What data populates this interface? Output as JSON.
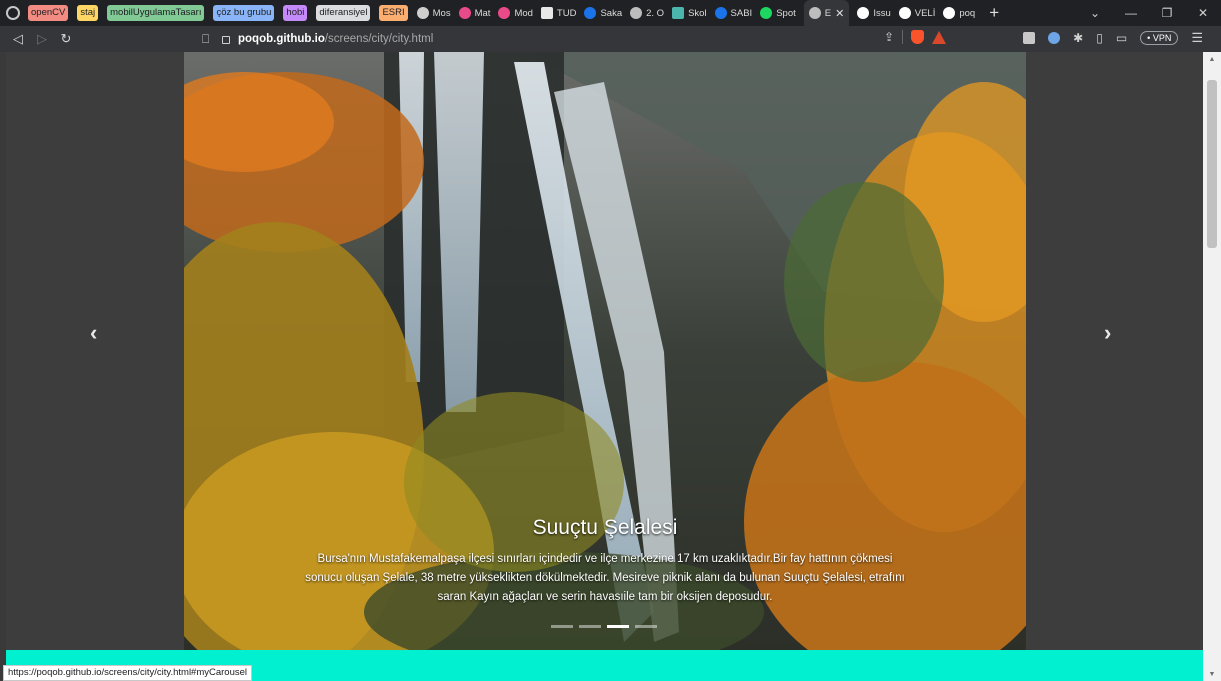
{
  "tab_groups": [
    {
      "label": "openCV",
      "color": "#f28b82"
    },
    {
      "label": "staj",
      "color": "#fdd663"
    },
    {
      "label": "mobilUygulamaTasarı",
      "color": "#81c995"
    },
    {
      "label": "çöz bu grubu",
      "color": "#8ab4f8"
    },
    {
      "label": "hobi",
      "color": "#c58af9"
    },
    {
      "label": "diferansiyel",
      "color": "#dadce0"
    },
    {
      "label": "ESRI",
      "color": "#fcad70"
    }
  ],
  "tabs": [
    {
      "label": "Mos",
      "icon": "cloud-icon",
      "color": "#cfcfcf"
    },
    {
      "label": "Mat",
      "icon": "circle-icon",
      "color": "#e84a8a"
    },
    {
      "label": "Mod",
      "icon": "circle-icon",
      "color": "#e84a8a"
    },
    {
      "label": "TUD",
      "icon": "document-icon",
      "color": "#e8e8e8"
    },
    {
      "label": "Saka",
      "icon": "circle-icon",
      "color": "#1a73e8"
    },
    {
      "label": "2. O",
      "icon": "globe-icon",
      "color": "#bdbdbd"
    },
    {
      "label": "Skol",
      "icon": "square-icon",
      "color": "#4db6ac"
    },
    {
      "label": "SABI",
      "icon": "circle-icon",
      "color": "#1a73e8"
    },
    {
      "label": "Spot",
      "icon": "spotify-icon",
      "color": "#1ed760"
    },
    {
      "label": "E",
      "icon": "globe-icon",
      "color": "#bdbdbd",
      "active": true
    },
    {
      "label": "Issu",
      "icon": "github-icon",
      "color": "#ffffff"
    },
    {
      "label": "VELİ",
      "icon": "github-icon",
      "color": "#ffffff"
    },
    {
      "label": "poq",
      "icon": "github-icon",
      "color": "#ffffff"
    }
  ],
  "toolbar": {
    "url_host": "poqob.github.io",
    "url_path": "/screens/city/city.html",
    "vpn_label": "• VPN"
  },
  "carousel": {
    "title": "Suuçtu Şelalesi",
    "description": "Bursa'nın Mustafakemalpaşa ilçesi sınırları içindedir ve ilçe merkezine 17 km uzaklıktadır.Bir fay hattının çökmesi sonucu oluşan Şelale, 38 metre yükseklikten dökülmektedir. Mesireve piknik alanı da bulunan Suuçtu Şelalesi, etrafını saran Kayın ağaçları ve serin havasıile tam bir oksijen deposudur.",
    "prev_symbol": "‹",
    "next_symbol": "›",
    "slide_count": 4,
    "active_slide": 3,
    "accent_color": "#00f0d0"
  },
  "status_url": "https://poqob.github.io/screens/city/city.html#myCarousel"
}
